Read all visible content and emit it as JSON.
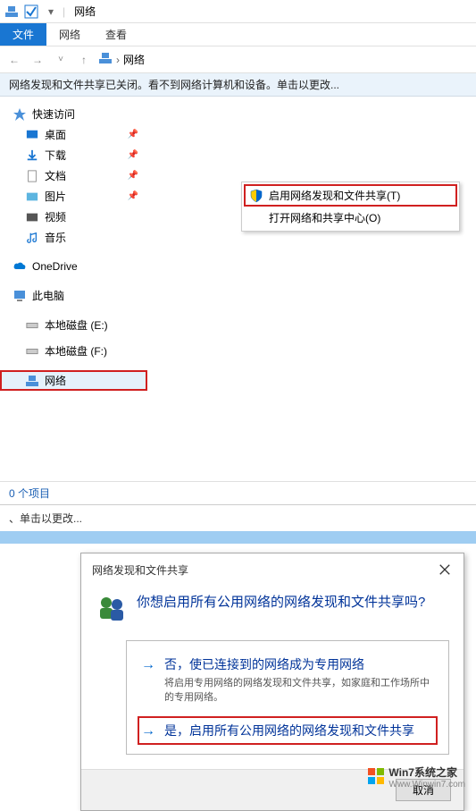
{
  "titlebar": {
    "title": "网络"
  },
  "ribbon": {
    "file": "文件",
    "network": "网络",
    "view": "查看"
  },
  "breadcrumb": {
    "root": "网络"
  },
  "infobar": {
    "message": "网络发现和文件共享已关闭。看不到网络计算机和设备。单击以更改..."
  },
  "context_menu": {
    "item1": "启用网络发现和文件共享(T)",
    "item2": "打开网络和共享中心(O)"
  },
  "sidebar": {
    "quick_access": "快速访问",
    "desktop": "桌面",
    "downloads": "下载",
    "documents": "文档",
    "pictures": "图片",
    "videos": "视频",
    "music": "音乐",
    "onedrive": "OneDrive",
    "thispc": "此电脑",
    "drive_e": "本地磁盘 (E:)",
    "drive_f": "本地磁盘 (F:)",
    "network": "网络"
  },
  "statusbar": {
    "items": "0 个项目"
  },
  "partial": {
    "text": "、单击以更改..."
  },
  "dialog": {
    "header": "网络发现和文件共享",
    "question": "你想启用所有公用网络的网络发现和文件共享吗?",
    "option1_title": "否，使已连接到的网络成为专用网络",
    "option1_desc": "将启用专用网络的网络发现和文件共享，如家庭和工作场所中的专用网络。",
    "option2_title": "是，启用所有公用网络的网络发现和文件共享",
    "cancel": "取消"
  },
  "watermark": {
    "main": "Win7系统之家",
    "url": "Www.Winwin7.com"
  }
}
